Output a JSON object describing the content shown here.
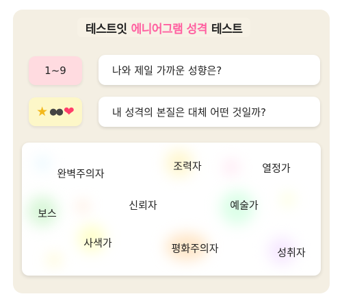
{
  "title": {
    "prefix": "테스트잇",
    "accent": "에니어그램 성격",
    "suffix": "테스트",
    "accent_color": "#ff5fa0"
  },
  "questions": [
    {
      "tag": "1~9",
      "text": "나와 제일 가까운 성향은?"
    },
    {
      "tag_icons": [
        "star-icon",
        "dots-icon",
        "heart-icon"
      ],
      "text": "내 성격의 본질은 대체 어떤 것일까?"
    }
  ],
  "types": [
    "완벽주의자",
    "조력자",
    "열정가",
    "보스",
    "신뢰자",
    "예술가",
    "사색가",
    "평화주의자",
    "성취자"
  ]
}
